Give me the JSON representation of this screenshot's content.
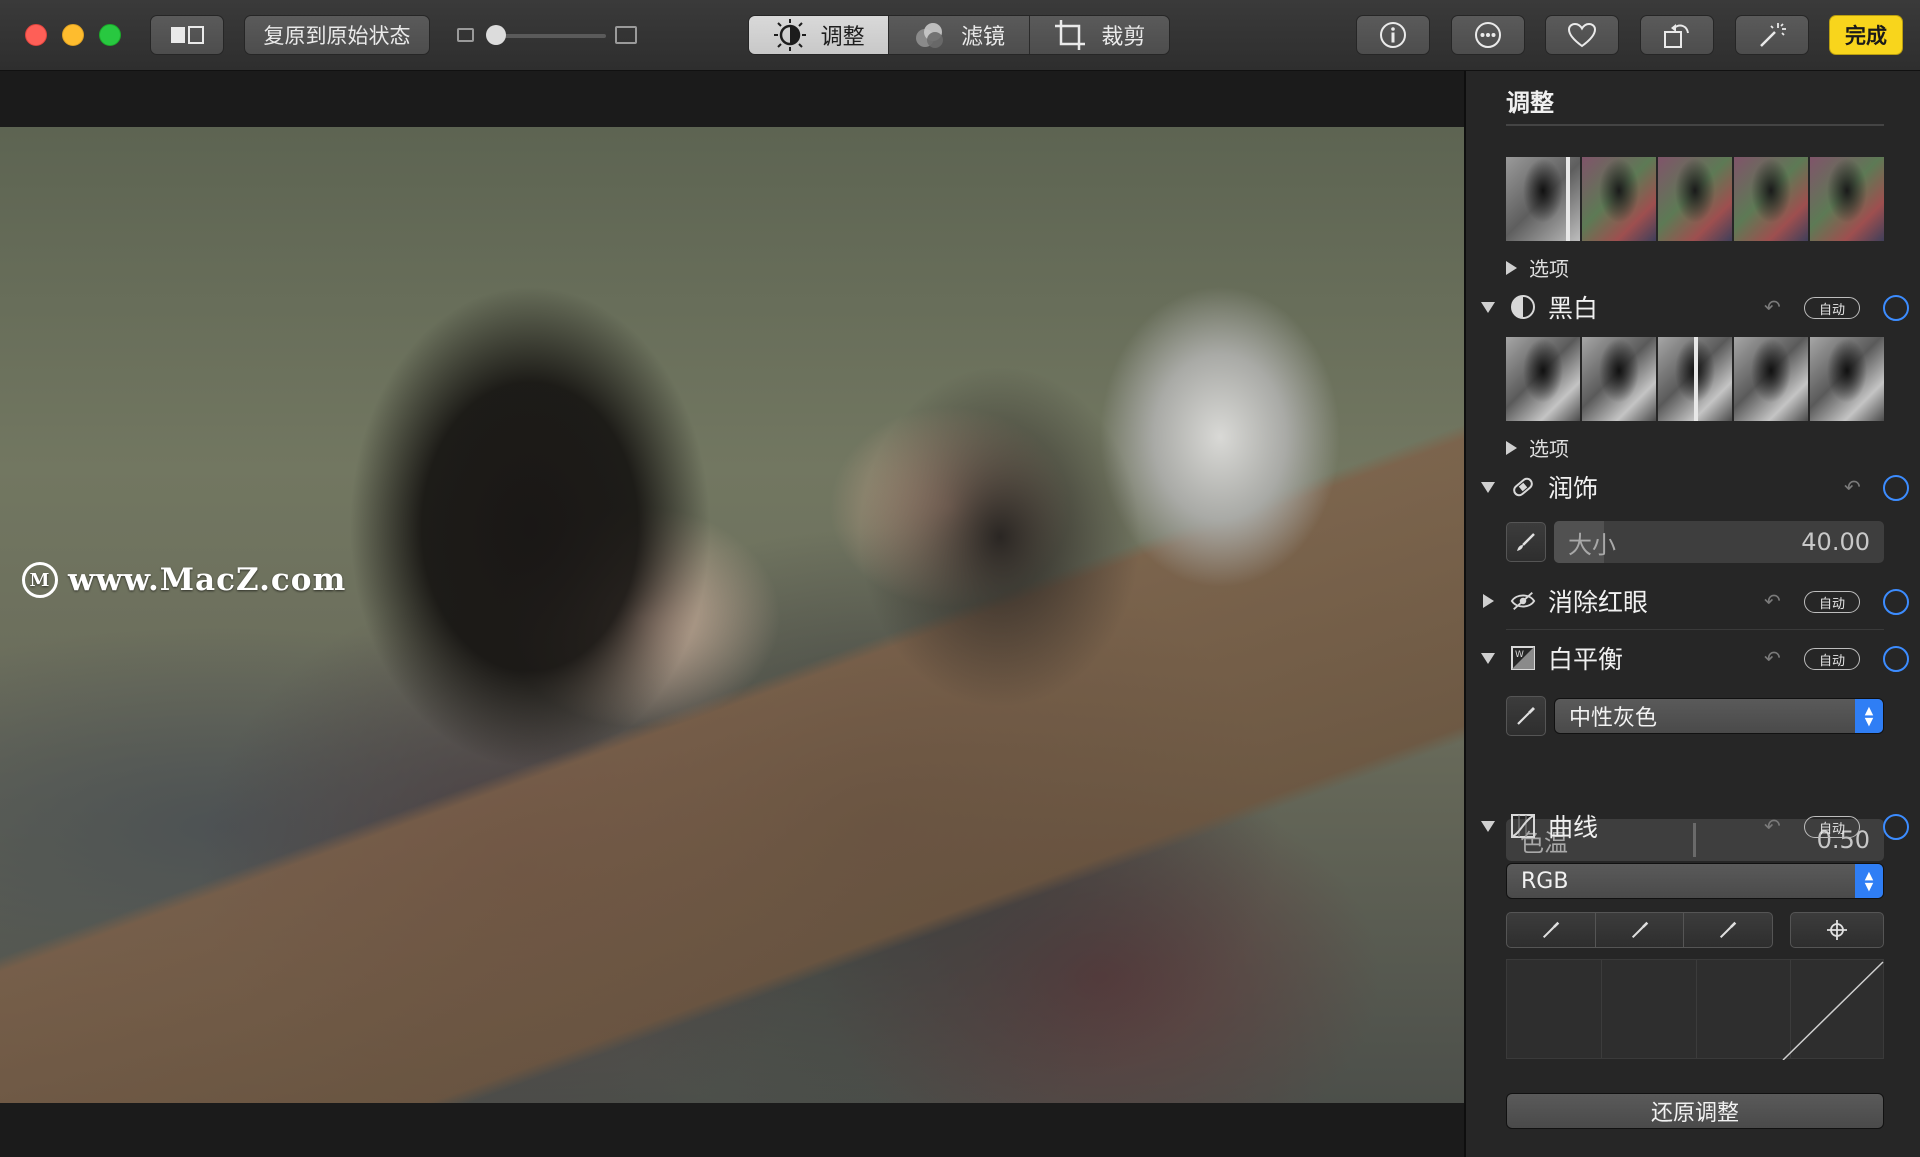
{
  "toolbar": {
    "revert_label": "复原到原始状态",
    "tabs": [
      {
        "label": "调整",
        "icon": "sun-dial-icon",
        "active": true
      },
      {
        "label": "滤镜",
        "icon": "filter-circles-icon",
        "active": false
      },
      {
        "label": "裁剪",
        "icon": "crop-icon",
        "active": false
      }
    ],
    "done_label": "完成"
  },
  "photo": {
    "watermark": "www.MacZ.com"
  },
  "sidebar": {
    "title": "调整",
    "light_options_label": "选项",
    "bw": {
      "label": "黑白",
      "auto_label": "自动",
      "options_label": "选项"
    },
    "retouch": {
      "label": "润饰",
      "size_label": "大小",
      "size_value": "40.00",
      "size_level": 0.15
    },
    "redeye": {
      "label": "消除红眼",
      "auto_label": "自动"
    },
    "white_balance": {
      "label": "白平衡",
      "auto_label": "自动",
      "mode": "中性灰色",
      "temp_label": "色温",
      "temp_value": "0.50"
    },
    "curves": {
      "label": "曲线",
      "auto_label": "自动",
      "channel": "RGB"
    },
    "reset_label": "还原调整"
  },
  "colors": {
    "accent_blue": "#3c8cff",
    "done_yellow": "#f8d51c",
    "close_red": "#fe5f57",
    "minimize_yellow": "#febc2e",
    "zoom_green": "#28c840"
  }
}
